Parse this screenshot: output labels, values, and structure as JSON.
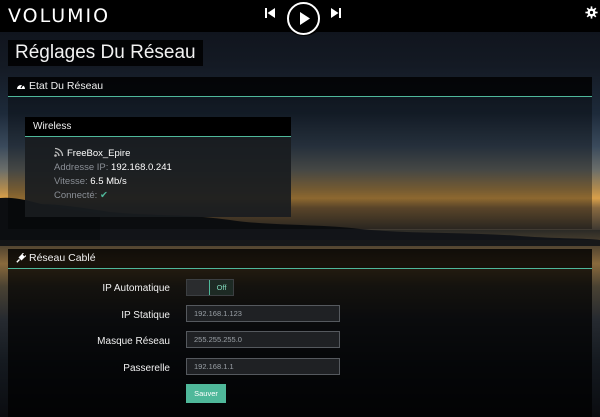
{
  "app": {
    "logo": "VOLUMIO"
  },
  "page": {
    "title": "Réglages Du Réseau"
  },
  "network_status": {
    "header": "Etat Du Réseau",
    "wireless": {
      "header": "Wireless",
      "ssid": "FreeBox_Epire",
      "ip_label": "Addresse IP:",
      "ip_value": "192.168.0.241",
      "speed_label": "Vitesse:",
      "speed_value": "6.5 Mb/s",
      "connected_label": "Connecté:",
      "connected_mark": "✔"
    }
  },
  "wired": {
    "header": "Réseau Cablé",
    "auto_ip_label": "IP Automatique",
    "auto_ip_state": "Off",
    "static_ip_label": "IP Statique",
    "static_ip_value": "192.168.1.123",
    "mask_label": "Masque Réseau",
    "mask_value": "255.255.255.0",
    "gateway_label": "Passerelle",
    "gateway_value": "192.168.1.1",
    "save_label": "Sauver"
  },
  "colors": {
    "accent": "#4fb89a",
    "bar": "#000000"
  },
  "icons": {
    "prev": "skip-previous-icon",
    "play": "play-icon",
    "next": "skip-next-icon",
    "settings": "gear-icon",
    "status": "dashboard-icon",
    "wifi": "wifi-signal-icon",
    "wired": "plug-icon"
  }
}
